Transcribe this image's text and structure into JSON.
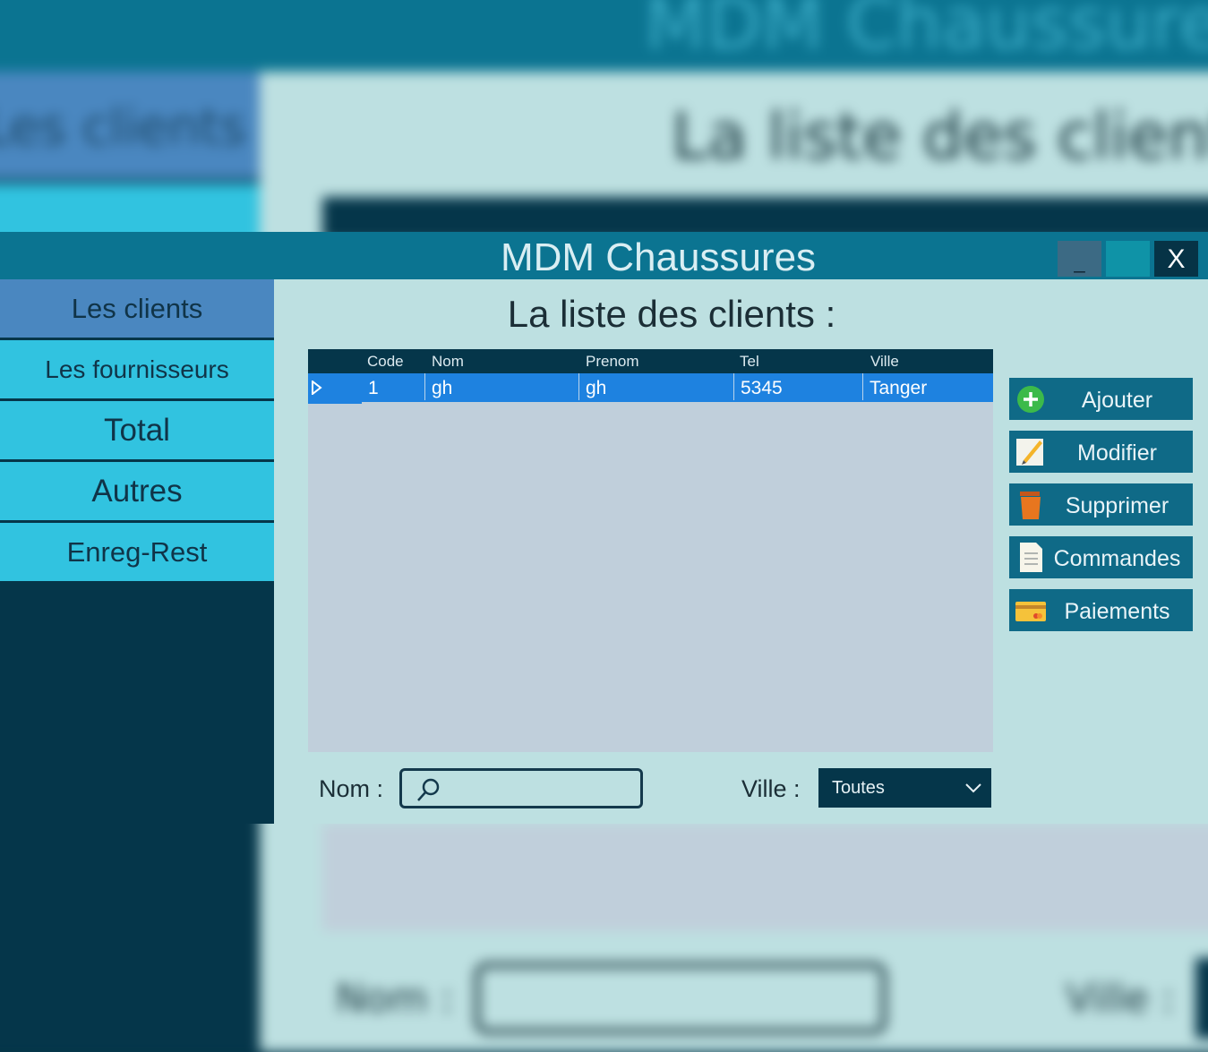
{
  "app": {
    "title": "MDM Chaussures",
    "window_controls": {
      "minimize": "_",
      "close": "X"
    }
  },
  "sidebar": {
    "items": [
      {
        "label": "Les clients",
        "active": true
      },
      {
        "label": "Les fournisseurs",
        "active": false
      },
      {
        "label": "Total",
        "active": false
      },
      {
        "label": "Autres",
        "active": false
      },
      {
        "label": "Enreg-Rest",
        "active": false
      }
    ]
  },
  "main": {
    "heading": "La liste des clients :",
    "table": {
      "columns": [
        "Code",
        "Nom",
        "Prenom",
        "Tel",
        "Ville"
      ],
      "rows": [
        {
          "code": "1",
          "nom": "gh",
          "prenom": "gh",
          "tel": "5345",
          "ville": "Tanger",
          "selected": true
        }
      ]
    },
    "actions": [
      {
        "label": "Ajouter",
        "icon": "add-icon"
      },
      {
        "label": "Modifier",
        "icon": "edit-icon"
      },
      {
        "label": "Supprimer",
        "icon": "trash-icon"
      },
      {
        "label": "Commandes",
        "icon": "document-icon"
      },
      {
        "label": "Paiements",
        "icon": "credit-card-icon"
      }
    ],
    "filters": {
      "nom_label": "Nom :",
      "nom_value": "",
      "ville_label": "Ville :",
      "ville_selected": "Toutes"
    }
  },
  "colors": {
    "titlebar": "#0b7491",
    "sidebar_bg": "#05364a",
    "sidebar_item": "#31c3e0",
    "sidebar_active": "#4a87c0",
    "content_bg": "#bde0e1",
    "grid_bg": "#c0cfdb",
    "selected_row": "#1e82e0",
    "action_button": "#0f6a87"
  }
}
